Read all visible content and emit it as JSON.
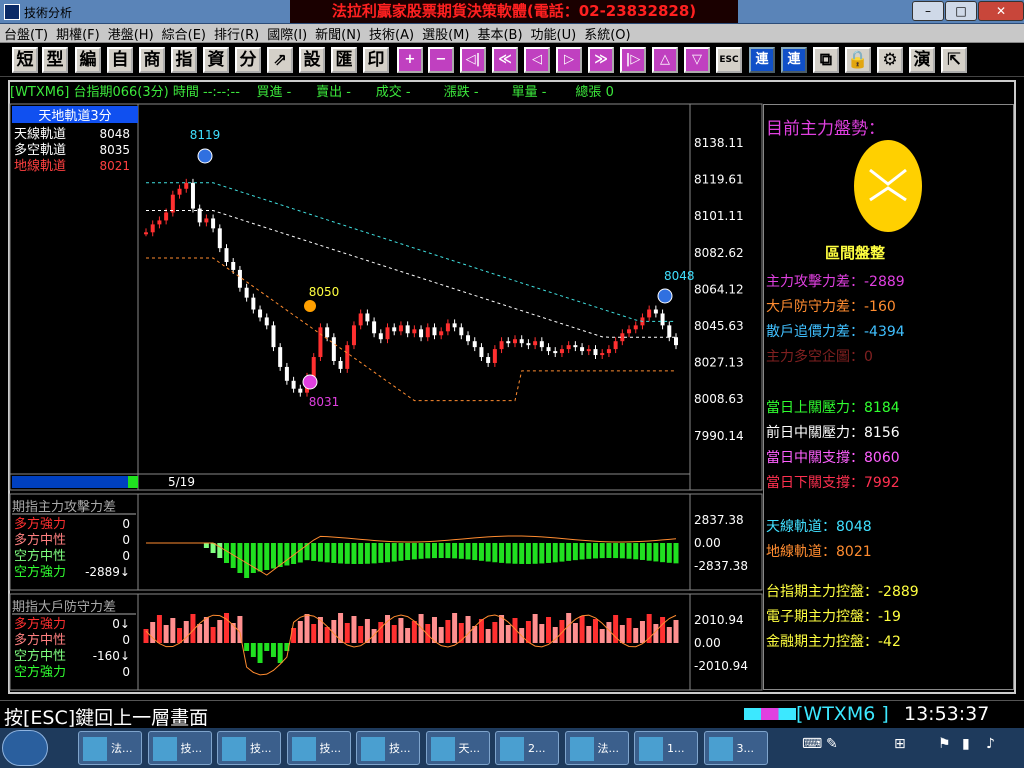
{
  "window": {
    "title": "技術分析",
    "banner": "法拉利贏家股票期貨決策軟體(電話：02-23832828)"
  },
  "menu": [
    "台盤(T)",
    "期權(F)",
    "港盤(H)",
    "綜合(E)",
    "排行(R)",
    "國際(I)",
    "新聞(N)",
    "技術(A)",
    "選股(M)",
    "基本(B)",
    "功能(U)",
    "系統(O)"
  ],
  "toolbar": [
    "短",
    "型",
    "編",
    "自",
    "商",
    "指",
    "資",
    "分",
    "⇗",
    "設",
    "匯",
    "印",
    "+",
    "−",
    "◁|",
    "≪",
    "◁",
    "▷",
    "≫",
    "|▷",
    "△",
    "▽",
    "ESC",
    "連",
    "連",
    "⧉",
    "🔒",
    "⚙",
    "演",
    "⇱"
  ],
  "header": {
    "code": "[WTXM6]",
    "name": "台指期066(3分)",
    "time_label": "時間",
    "time_val": "--:--:--",
    "buy_label": "買進",
    "buy_val": "-",
    "sell_label": "賣出",
    "sell_val": "-",
    "deal_label": "成交",
    "deal_val": "-",
    "chg_label": "漲跌",
    "chg_val": "-",
    "vol_label": "單量",
    "vol_val": "-",
    "tot_label": "總張",
    "tot_val": "0"
  },
  "legend": {
    "title": "天地軌道3分",
    "rows": [
      {
        "label": "天線軌道",
        "value": "8048",
        "color": "#ffffff"
      },
      {
        "label": "多空軌道",
        "value": "8035",
        "color": "#ffffff"
      },
      {
        "label": "地線軌道",
        "value": "8021",
        "color": "#ff4040"
      }
    ]
  },
  "price_axis": [
    "8138.11",
    "8119.61",
    "8101.11",
    "8082.62",
    "8064.12",
    "8045.63",
    "8027.13",
    "8008.63",
    "7990.14"
  ],
  "markers": {
    "high": "8119",
    "mid": "8050",
    "low": "8031",
    "right": "8048",
    "date": "5/19"
  },
  "ind1": {
    "title": "期指主力攻擊力差",
    "axis": [
      "2837.38",
      "0.00",
      "-2837.38"
    ],
    "rows": [
      {
        "label": "多方強力",
        "value": "0",
        "color": "#ff3030"
      },
      {
        "label": "多方中性",
        "value": "0",
        "color": "#ff8080"
      },
      {
        "label": "空方中性",
        "value": "0",
        "color": "#80ff80"
      },
      {
        "label": "空方強力",
        "value": "-2889↓",
        "color": "#30ff30"
      }
    ]
  },
  "ind2": {
    "title": "期指大戶防守力差",
    "axis": [
      "2010.94",
      "0.00",
      "-2010.94"
    ],
    "rows": [
      {
        "label": "多方強力",
        "value": "0↓",
        "color": "#ff3030"
      },
      {
        "label": "多方中性",
        "value": "0",
        "color": "#ff8080"
      },
      {
        "label": "空方中性",
        "value": "-160↓",
        "color": "#80ff80"
      },
      {
        "label": "空方強力",
        "value": "0",
        "color": "#30ff30"
      }
    ]
  },
  "right": {
    "heading": "目前主力盤勢：",
    "badge": "區間盤整",
    "stats": [
      {
        "label": "主力攻擊力差：",
        "value": "-2889",
        "color": "#e040e0"
      },
      {
        "label": "大戶防守力差：",
        "value": "-160",
        "color": "#ff8c30"
      },
      {
        "label": "散戶追價力差：",
        "value": "-4394",
        "color": "#40c0ff"
      },
      {
        "label": "主力多空企圖：",
        "value": "0",
        "color": "#802020"
      }
    ],
    "levels": [
      {
        "label": "當日上關壓力：",
        "value": "8184",
        "color": "#30ff30"
      },
      {
        "label": "前日中關壓力：",
        "value": "8156",
        "color": "#ffffff"
      },
      {
        "label": "當日中關支撐：",
        "value": "8060",
        "color": "#ff60ff"
      },
      {
        "label": "當日下關支撐：",
        "value": "7992",
        "color": "#ff3050"
      }
    ],
    "tracks": [
      {
        "label": "天線軌道：",
        "value": "8048",
        "color": "#40e0ff"
      },
      {
        "label": "地線軌道：",
        "value": "8021",
        "color": "#ff8c30"
      }
    ],
    "control": [
      {
        "label": "台指期主力控盤：",
        "value": "-2889",
        "color": "#ffff40"
      },
      {
        "label": "電子期主力控盤：",
        "value": "-19",
        "color": "#ffff40"
      },
      {
        "label": "金融期主力控盤：",
        "value": "-42",
        "color": "#ffff40"
      }
    ]
  },
  "status": {
    "esc": "按[ESC]鍵回上一層畫面",
    "code": "[WTXM6 ]",
    "time": "13:53:37"
  },
  "taskbar": [
    {
      "label": "法..."
    },
    {
      "label": "技..."
    },
    {
      "label": "技..."
    },
    {
      "label": "技..."
    },
    {
      "label": "技..."
    },
    {
      "label": "天..."
    },
    {
      "label": "2..."
    },
    {
      "label": "法..."
    },
    {
      "label": "1..."
    },
    {
      "label": "3..."
    }
  ]
}
